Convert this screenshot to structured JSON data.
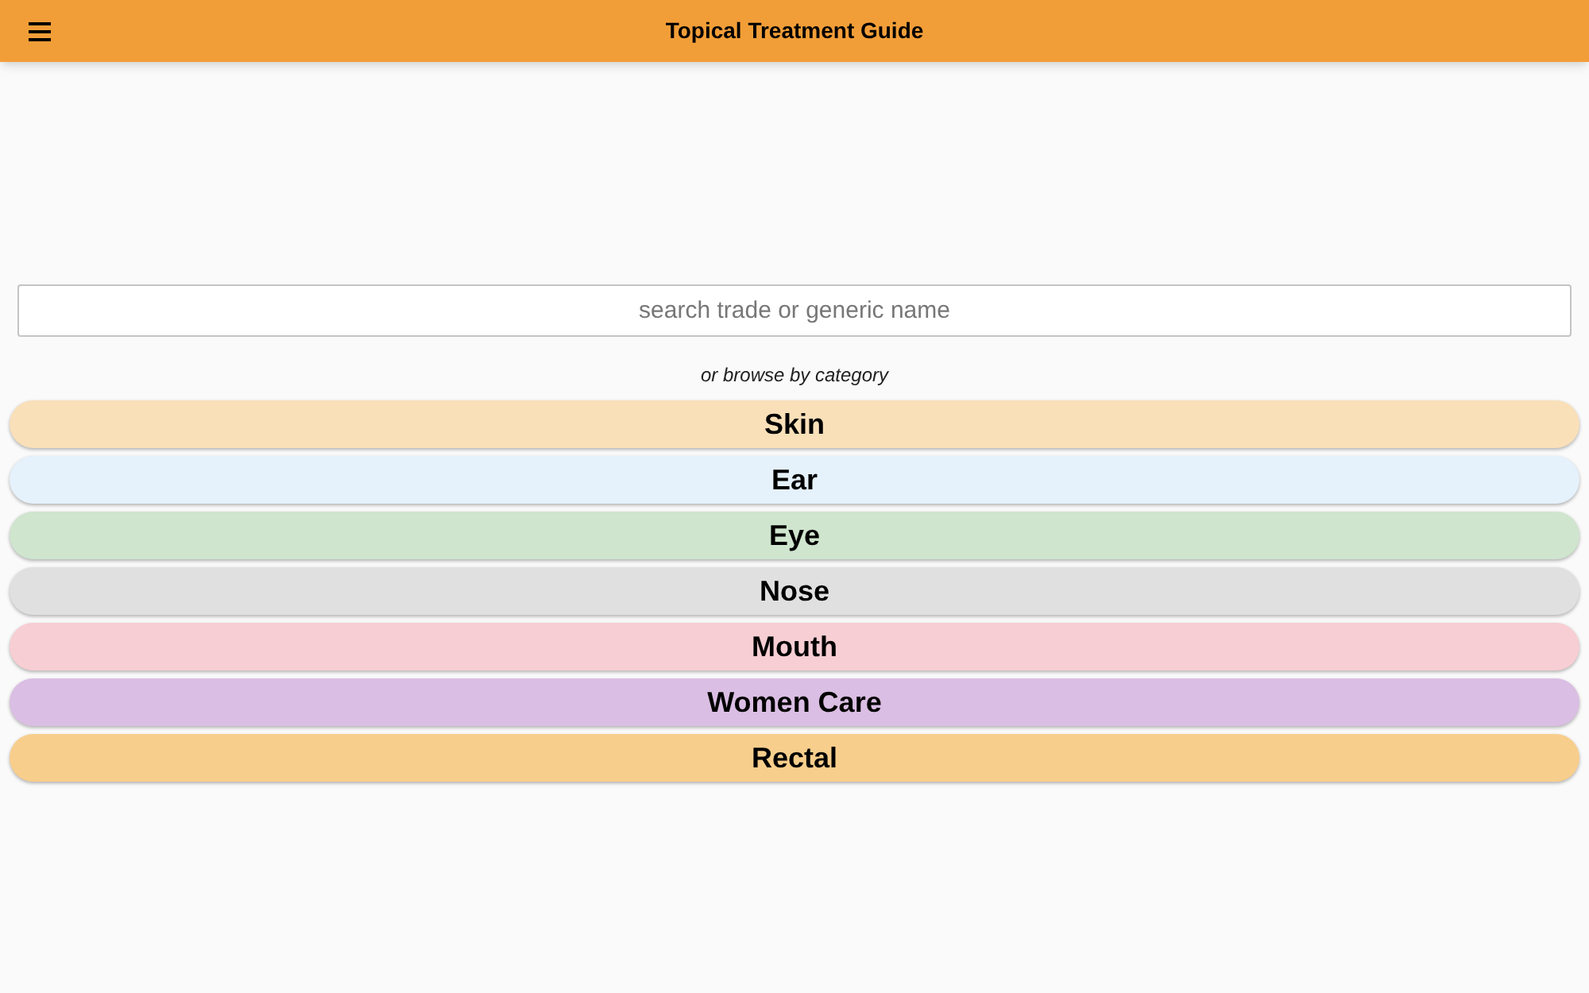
{
  "app_bar": {
    "title": "Topical Treatment Guide"
  },
  "search": {
    "placeholder": "search trade or generic name"
  },
  "browse_hint": "or browse by category",
  "categories": [
    {
      "label": "Skin",
      "color": "#f9e0b9"
    },
    {
      "label": "Ear",
      "color": "#e5f1fb"
    },
    {
      "label": "Eye",
      "color": "#cfe5ce"
    },
    {
      "label": "Nose",
      "color": "#e0e0e0"
    },
    {
      "label": "Mouth",
      "color": "#f7ced3"
    },
    {
      "label": "Women Care",
      "color": "#dbbee3"
    },
    {
      "label": "Rectal",
      "color": "#f8ce8c"
    }
  ]
}
